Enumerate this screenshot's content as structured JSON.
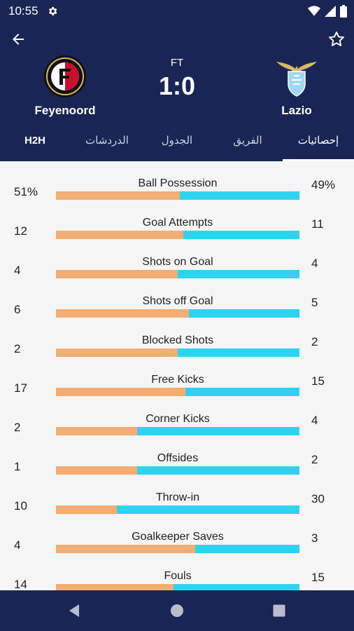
{
  "status_bar": {
    "time": "10:55",
    "icons": [
      "gear-icon",
      "wifi-icon",
      "signal-icon",
      "battery-icon"
    ]
  },
  "header": {
    "match_status": "FT",
    "score": "1:0",
    "home_team": {
      "name": "Feyenoord"
    },
    "away_team": {
      "name": "Lazio"
    }
  },
  "tabs": [
    {
      "label": "H2H"
    },
    {
      "label": "الدردشات"
    },
    {
      "label": "الجدول"
    },
    {
      "label": "الفريق"
    },
    {
      "label": "إحصائيات",
      "active": true
    }
  ],
  "stats": [
    {
      "label": "Ball Possession",
      "home": "51%",
      "away": "49%",
      "home_share": 0.51
    },
    {
      "label": "Goal Attempts",
      "home": "12",
      "away": "11",
      "home_share": 0.522
    },
    {
      "label": "Shots on Goal",
      "home": "4",
      "away": "4",
      "home_share": 0.5
    },
    {
      "label": "Shots off Goal",
      "home": "6",
      "away": "5",
      "home_share": 0.545
    },
    {
      "label": "Blocked Shots",
      "home": "2",
      "away": "2",
      "home_share": 0.5
    },
    {
      "label": "Free Kicks",
      "home": "17",
      "away": "15",
      "home_share": 0.531
    },
    {
      "label": "Corner Kicks",
      "home": "2",
      "away": "4",
      "home_share": 0.333
    },
    {
      "label": "Offsides",
      "home": "1",
      "away": "2",
      "home_share": 0.333
    },
    {
      "label": "Throw-in",
      "home": "10",
      "away": "30",
      "home_share": 0.25
    },
    {
      "label": "Goalkeeper Saves",
      "home": "4",
      "away": "3",
      "home_share": 0.571
    },
    {
      "label": "Fouls",
      "home": "14",
      "away": "15",
      "home_share": 0.483
    }
  ],
  "colors": {
    "header_bg": "#192655",
    "home_bar": "#f4ad72",
    "away_bar": "#2ed3ef",
    "content_bg": "#f5f5f5"
  }
}
